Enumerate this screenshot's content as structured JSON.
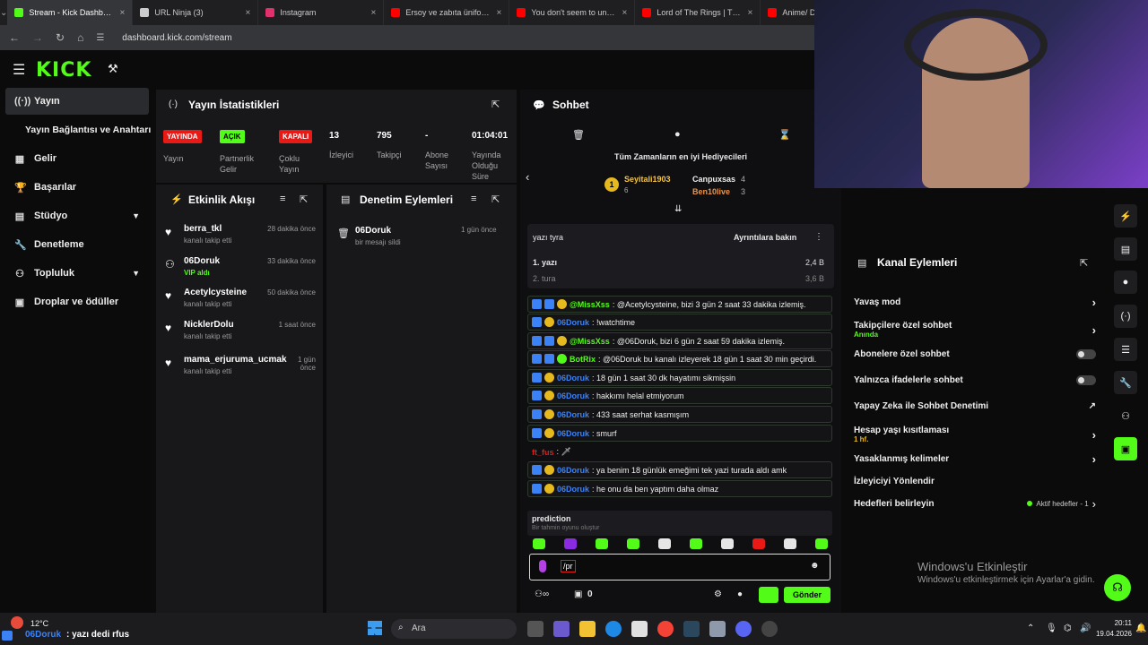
{
  "browser": {
    "tabs": [
      {
        "label": "Stream - Kick Dashboard",
        "color": "#53fc18"
      },
      {
        "label": "URL Ninja (3)",
        "color": "#cccccc"
      },
      {
        "label": "Instagram",
        "color": "#e1306c"
      },
      {
        "label": "Ersoy ve zabıta üniformas",
        "color": "#ff0000"
      },
      {
        "label": "You don't seem to unders",
        "color": "#ff0000"
      },
      {
        "label": "Lord of The Rings | The S",
        "color": "#ff0000"
      },
      {
        "label": "Anime/ D",
        "color": "#ff0000"
      }
    ],
    "url": "dashboard.kick.com/stream"
  },
  "logo": "KICK",
  "sidebar": {
    "items": [
      {
        "label": "Yayın",
        "icon": "broadcast-icon"
      },
      {
        "label": "Yayın Bağlantısı ve Anahtarı",
        "icon": ""
      },
      {
        "label": "Gelir",
        "icon": "chart-icon"
      },
      {
        "label": "Başarılar",
        "icon": "trophy-icon"
      },
      {
        "label": "Stüdyo",
        "icon": "studio-icon"
      },
      {
        "label": "Denetleme",
        "icon": "wrench-icon"
      },
      {
        "label": "Topluluk",
        "icon": "community-icon"
      },
      {
        "label": "Droplar ve ödüller",
        "icon": "drops-icon"
      }
    ]
  },
  "stats": {
    "title": "Yayın İstatistikleri",
    "badges": [
      {
        "badge": "YAYINDA",
        "label": "Yayın",
        "color": "#e91916"
      },
      {
        "badge": "AÇIK",
        "label": "Partnerlik Gelir Programı",
        "color": "#53fc18"
      },
      {
        "badge": "KAPALI",
        "label": "Çoklu Yayın",
        "color": "#e91916"
      }
    ],
    "numbers": [
      {
        "value": "13",
        "label": "İzleyici"
      },
      {
        "value": "795",
        "label": "Takipçi"
      },
      {
        "value": "-",
        "label": "Abone Sayısı"
      },
      {
        "value": "01:04:01",
        "label": "Yayında Olduğu Süre"
      }
    ]
  },
  "activity": {
    "title": "Etkinlik Akışı",
    "items": [
      {
        "name": "berra_tkl",
        "sub": "kanalı takip etti",
        "time": "28 dakika önce",
        "sub_color": "#999999"
      },
      {
        "name": "06Doruk",
        "sub": "VIP aldı",
        "time": "33 dakika önce",
        "sub_color": "#53fc18"
      },
      {
        "name": "Acetylcysteine",
        "sub": "kanalı takip etti",
        "time": "50 dakika önce",
        "sub_color": "#999999"
      },
      {
        "name": "NicklerDolu",
        "sub": "kanalı takip etti",
        "time": "1 saat önce",
        "sub_color": "#999999"
      },
      {
        "name": "mama_erjuruma_ucmak",
        "sub": "kanalı takip etti",
        "time": "1 gün önce",
        "sub_color": "#999999"
      }
    ]
  },
  "moderation": {
    "title": "Denetim Eylemleri",
    "items": [
      {
        "name": "06Doruk",
        "sub": "bir mesajı sildi",
        "time": "1 gün önce"
      }
    ]
  },
  "chat": {
    "title": "Sohbet",
    "gifters_title": "Tüm Zamanların en iyi Hediyecileri",
    "gifters": [
      {
        "name": "Seyitali1903",
        "count": "6"
      },
      {
        "name": "Canpuxsas",
        "count": "4"
      },
      {
        "name": "Ben10live",
        "count": "3"
      }
    ],
    "poll": {
      "title": "yazı tyra",
      "details": "Ayrıntılara bakın",
      "options": [
        {
          "label": "1. yazı",
          "value": "2,4 B"
        },
        {
          "label": "2. tura",
          "value": "3,6 B"
        }
      ]
    },
    "messages": [
      {
        "user": "@MissXss",
        "text": ": @Acetylcysteine, bizi 3 gün 2 saat 33 dakika izlemiş.",
        "color": "#53fc18"
      },
      {
        "user": "06Doruk",
        "text": ": !watchtime",
        "color": "#3b82f6"
      },
      {
        "user": "@MissXss",
        "text": ": @06Doruk, bizi 6 gün 2 saat 59 dakika izlemiş.",
        "color": "#53fc18"
      },
      {
        "user": "BotRix",
        "text": ": @06Doruk bu kanalı izleyerek 18 gün 1 saat 30 min geçirdi.",
        "color": "#53fc18"
      },
      {
        "user": "06Doruk",
        "text": ": 18 gün 1 saat 30 dk hayatımı sikmişsin",
        "color": "#3b82f6"
      },
      {
        "user": "06Doruk",
        "text": ": hakkımı helal etmiyorum",
        "color": "#3b82f6"
      },
      {
        "user": "06Doruk",
        "text": ": 433 saat serhat kasmışım",
        "color": "#3b82f6"
      },
      {
        "user": "06Doruk",
        "text": ": smurf",
        "color": "#3b82f6"
      },
      {
        "user": "ft_fus",
        "text": ": 🗡",
        "color": "#e91916"
      },
      {
        "user": "06Doruk",
        "text": ": ya benim 18 günlük emeğimi tek yazi turada aldı amk",
        "color": "#3b82f6"
      },
      {
        "user": "06Doruk",
        "text": ": he onu da ben yaptım daha olmaz",
        "color": "#3b82f6"
      }
    ],
    "suggestion": {
      "title": "prediction",
      "sub": "Bir tahmin oyunu oluştur"
    },
    "input_value": "/pr",
    "send_label": "Gönder",
    "points": "0"
  },
  "channel_actions": {
    "title": "Kanal Eylemleri",
    "rows": [
      {
        "label": "Yavaş mod",
        "sub": "",
        "right": "chevron"
      },
      {
        "label": "Takipçilere özel sohbet",
        "sub": "Anında",
        "right": "chevron"
      },
      {
        "label": "Abonelere özel sohbet",
        "sub": "",
        "right": "toggle"
      },
      {
        "label": "Yalnızca ifadelerle sohbet",
        "sub": "",
        "right": "toggle"
      },
      {
        "label": "Yapay Zeka ile Sohbet Denetimi",
        "sub": "",
        "right": "external"
      },
      {
        "label": "Hesap yaşı kısıtlaması",
        "sub": "1 hf.",
        "right": "chevron"
      },
      {
        "label": "Yasaklanmış kelimeler",
        "sub": "",
        "right": "chevron"
      },
      {
        "label": "İzleyiciyi Yönlendir",
        "sub": "",
        "right": ""
      },
      {
        "label": "Hedefleri belirleyin",
        "sub": "",
        "right": "goals"
      }
    ],
    "goals_label": "Aktif hedefler - 1"
  },
  "windows_watermark": {
    "title": "Windows'u Etkinleştir",
    "sub": "Windows'u etkinleştirmek için Ayarlar'a gidin."
  },
  "taskbar": {
    "weather": "12°C",
    "ticker_user": "06Doruk",
    "ticker_text": ": yazı dedi rfus",
    "search": "Ara",
    "time": "20:11",
    "date": "19.04.2026"
  }
}
